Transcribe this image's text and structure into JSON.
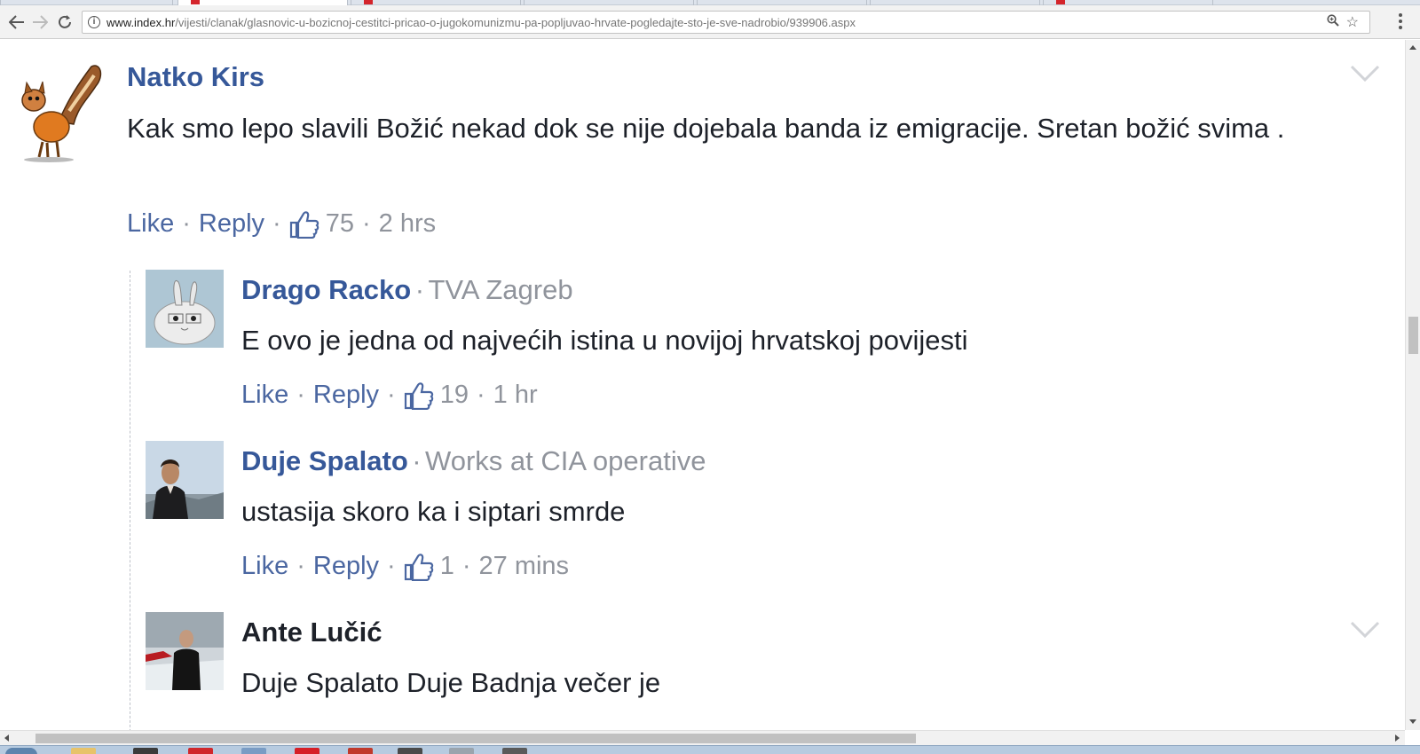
{
  "browser": {
    "url_host": "www.index.hr",
    "url_path": "/vijesti/clanak/glasnovic-u-bozicnoj-cestitci-pricao-o-jugokomunizmu-pa-popljuvao-hrvate-pogledajte-sto-je-sve-nadrobio/939906.aspx",
    "icons": {
      "back": "back-arrow-icon",
      "forward": "forward-arrow-icon",
      "reload": "reload-icon",
      "zoom": "zoom-icon",
      "bookmark": "star-icon",
      "menu": "kebab-menu-icon"
    }
  },
  "actions": {
    "like": "Like",
    "reply": "Reply",
    "dot": "·"
  },
  "comments": [
    {
      "author": "Natko Kirs",
      "affiliation": "",
      "text": "Kak smo lepo slavili Božić nekad dok se nije dojebala banda iz emigracije. Sretan božić svima .",
      "likes": "75",
      "time": "2 hrs"
    }
  ],
  "replies": [
    {
      "author": "Drago Racko",
      "affiliation": "TVA Zagreb",
      "text": "E ovo je jedna od najvećih istina u novijoj hrvatskoj povijesti",
      "likes": "19",
      "time": "1 hr"
    },
    {
      "author": "Duje Spalato",
      "affiliation": "Works at CIA operative",
      "text": "ustasija skoro ka i siptari smrde",
      "likes": "1",
      "time": "27 mins"
    },
    {
      "author": "Ante Lučić",
      "affiliation": "",
      "text": "Duje Spalato Duje Badnja večer je"
    }
  ],
  "colors": {
    "link": "#365899",
    "action_link": "#4b67a1",
    "meta": "#90949c",
    "text": "#1d2129"
  }
}
